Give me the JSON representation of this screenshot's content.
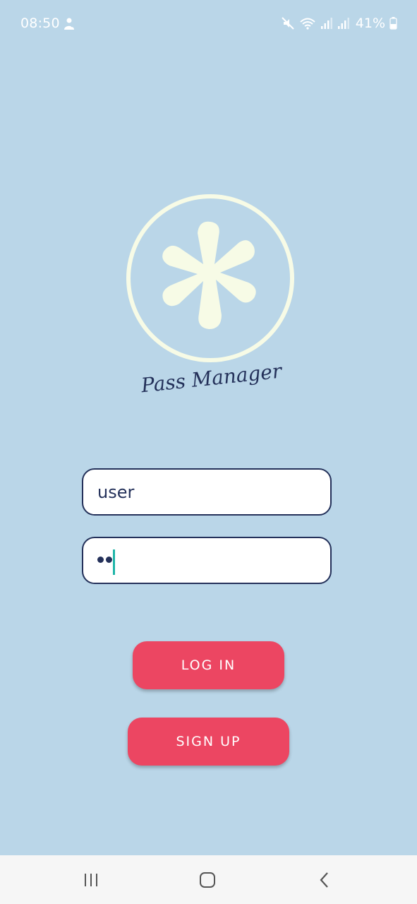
{
  "status_bar": {
    "time": "08:50",
    "battery": "41%",
    "icons": [
      "person-notification-icon",
      "mute-icon",
      "wifi-icon",
      "signal-icon",
      "signal-icon",
      "battery-icon"
    ]
  },
  "logo": {
    "icon": "asterisk-icon",
    "text": "Pass Manager",
    "color": "#f7fbe6",
    "text_color": "#24315a"
  },
  "form": {
    "username_value": "user",
    "password_masked_length": 2
  },
  "buttons": {
    "login_label": "LOG IN",
    "signup_label": "SIGN UP",
    "color": "#ec4662"
  },
  "nav_bar": {
    "icons": [
      "recents-icon",
      "home-icon",
      "back-icon"
    ]
  },
  "colors": {
    "background": "#bad6e8",
    "field_border": "#24315a",
    "caret": "#1fb5a8"
  }
}
